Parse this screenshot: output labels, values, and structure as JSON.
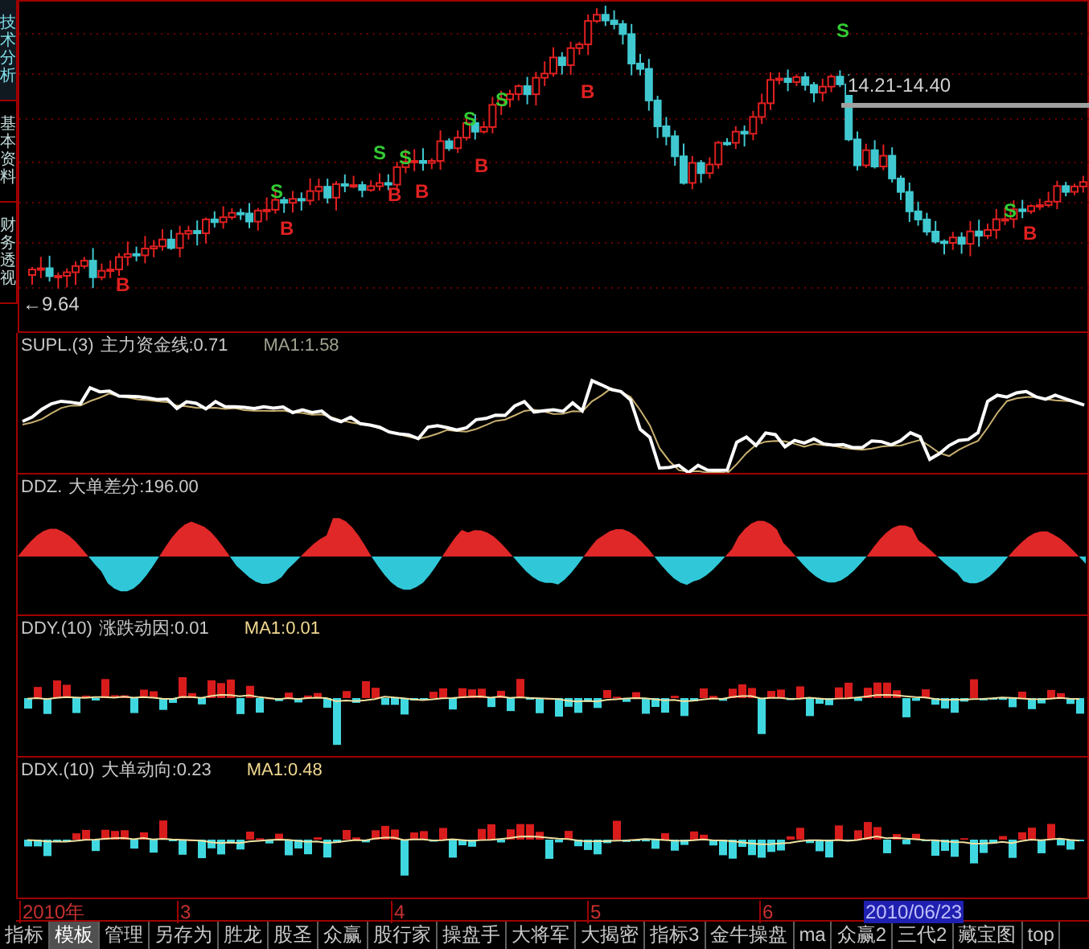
{
  "side_tabs": [
    {
      "label": "技术分析",
      "selected": true
    },
    {
      "label": "基本资料",
      "selected": false
    },
    {
      "label": "财务透视",
      "selected": false
    }
  ],
  "main_chart": {
    "low_label": "←9.64",
    "range_label": "14.21-14.40",
    "signals": [
      {
        "kind": "buy",
        "label": "B"
      },
      {
        "kind": "sell",
        "label": "S"
      },
      {
        "kind": "buy",
        "label": "B"
      },
      {
        "kind": "sell",
        "label": "S"
      },
      {
        "kind": "buy",
        "label": "B"
      },
      {
        "kind": "sell",
        "label": "S"
      },
      {
        "kind": "buy",
        "label": "B"
      },
      {
        "kind": "sell",
        "label": "S"
      },
      {
        "kind": "buy",
        "label": "B"
      },
      {
        "kind": "sell",
        "label": "S"
      },
      {
        "kind": "buy",
        "label": "B"
      },
      {
        "kind": "sell",
        "label": "S"
      },
      {
        "kind": "sell",
        "label": "S"
      },
      {
        "kind": "buy",
        "label": "B"
      }
    ]
  },
  "panels": [
    {
      "kind": "line",
      "name": "SUPL.(3)",
      "value": "主力资金线:0.71",
      "ma": "MA1:1.58"
    },
    {
      "kind": "area",
      "name": "DDZ.",
      "value": "大单差分:196.00"
    },
    {
      "kind": "bars",
      "name": "DDY.(10)",
      "value": "涨跌动因:0.01",
      "ma": "MA1:0.01"
    },
    {
      "kind": "bars",
      "name": "DDX.(10)",
      "value": "大单动向:0.23",
      "ma": "MA1:0.48"
    }
  ],
  "time_axis": {
    "labels": [
      "2010年",
      "3",
      "4",
      "5",
      "6"
    ],
    "cursor_date": "2010/06/23"
  },
  "bottom_tabs": [
    {
      "label": "指标",
      "selected": false
    },
    {
      "label": "模板",
      "selected": true
    },
    {
      "label": "管理",
      "selected": false
    },
    {
      "label": "另存为",
      "selected": false
    },
    {
      "label": "胜龙",
      "selected": false
    },
    {
      "label": "股圣",
      "selected": false
    },
    {
      "label": "众赢",
      "selected": false
    },
    {
      "label": "股行家",
      "selected": false
    },
    {
      "label": "操盘手",
      "selected": false
    },
    {
      "label": "大将军",
      "selected": false
    },
    {
      "label": "大揭密",
      "selected": false
    },
    {
      "label": "指标3",
      "selected": false
    },
    {
      "label": "金牛操盘",
      "selected": false
    },
    {
      "label": "ma",
      "selected": false
    },
    {
      "label": "众赢2",
      "selected": false
    },
    {
      "label": "三代2",
      "selected": false
    },
    {
      "label": "藏宝图",
      "selected": false
    },
    {
      "label": "top",
      "selected": false
    }
  ]
}
